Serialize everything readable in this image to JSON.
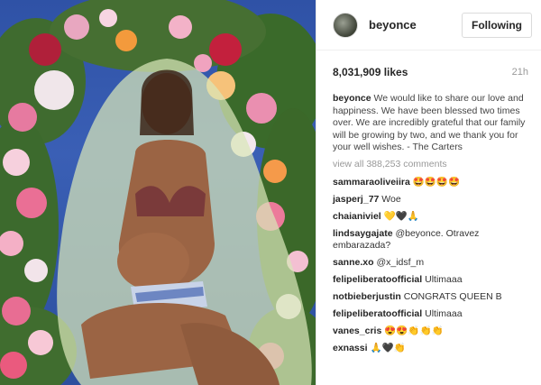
{
  "post": {
    "username": "beyonce",
    "follow_label": "Following",
    "likes": "8,031,909 likes",
    "time": "21h",
    "caption_user": "beyonce",
    "caption_text": "We would like to share our love and happiness. We have been blessed two times over. We are incredibly grateful that our family will be growing by two, and we thank you for your well wishes. - The Carters",
    "view_all": "view all 388,253 comments"
  },
  "comments": [
    {
      "user": "sammaraoliveiira",
      "text": "🤩🤩🤩🤩"
    },
    {
      "user": "jasperj_77",
      "text": "Woe"
    },
    {
      "user": "chaianiviel",
      "text": "💛🖤🙏"
    },
    {
      "user": "lindsaygajate",
      "text": "@beyonce. Otravez embarazada?"
    },
    {
      "user": "sanne.xo",
      "text": "@x_idsf_m"
    },
    {
      "user": "felipeliberatoofficial",
      "text": "Ultimaaa"
    },
    {
      "user": "notbieberjustin",
      "text": "CONGRATS QUEEN B"
    },
    {
      "user": "felipeliberatoofficial",
      "text": "Ultimaaa"
    },
    {
      "user": "vanes_cris",
      "text": "😍😍👏👏👏"
    },
    {
      "user": "exnassi",
      "text": "🙏🖤👏"
    }
  ],
  "colors": {
    "sky": "#3a5fb5",
    "link": "#999999",
    "veil": "#d8e6b8"
  },
  "icons": {
    "avatar": "profile-photo"
  }
}
